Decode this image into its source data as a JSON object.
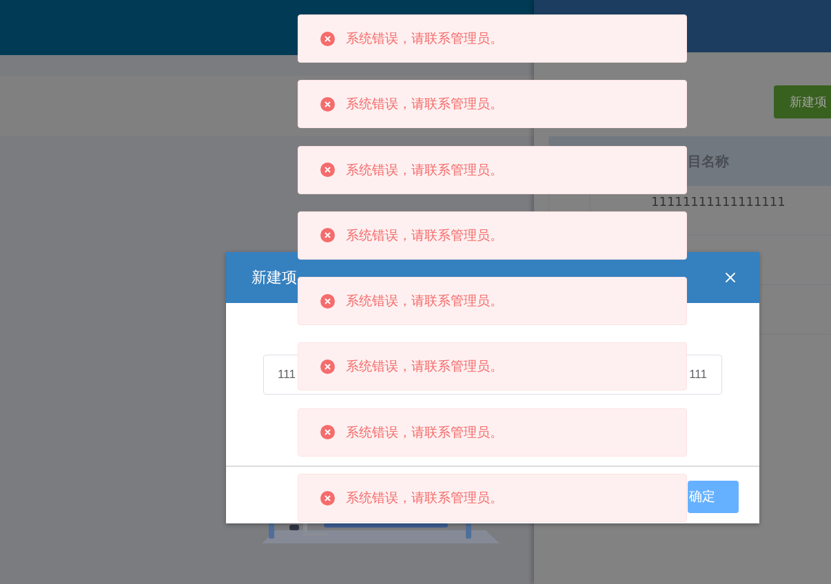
{
  "drawer": {
    "new_button": {
      "label": "新建项"
    },
    "table": {
      "columns": [
        "目名称"
      ],
      "rows": [
        {
          "cells": [
            "11111111111111111"
          ]
        }
      ]
    }
  },
  "dialog": {
    "title": "新建项",
    "field": {
      "value_fragments": [
        "111",
        "111"
      ]
    },
    "confirm_button": {
      "label": "确定"
    }
  },
  "toasts": [
    {
      "kind": "error",
      "message": "系统错误，请联系管理员。"
    },
    {
      "kind": "error",
      "message": "系统错误，请联系管理员。"
    },
    {
      "kind": "error",
      "message": "系统错误，请联系管理员。"
    },
    {
      "kind": "error",
      "message": "系统错误，请联系管理员。"
    },
    {
      "kind": "error",
      "message": "系统错误，请联系管理员。"
    },
    {
      "kind": "error",
      "message": "系统错误，请联系管理员。"
    },
    {
      "kind": "error",
      "message": "系统错误，请联系管理员。"
    },
    {
      "kind": "error",
      "message": "系统错误，请联系管理员。"
    }
  ]
}
